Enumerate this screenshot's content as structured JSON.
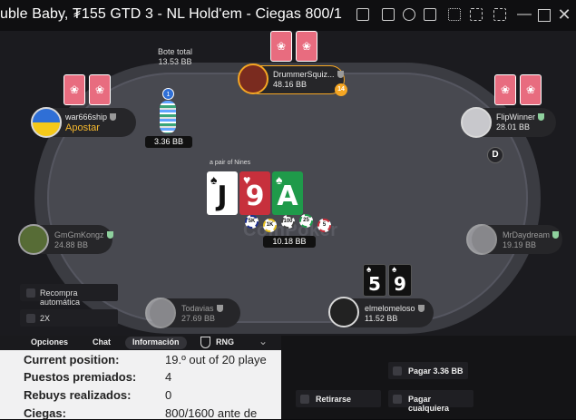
{
  "window": {
    "title": "uble Baby, ₮155 GTD 3 - NL Hold'em - Ciegas 800/1",
    "icons": [
      "info-icon",
      "wallet-icon",
      "history-icon",
      "share-icon",
      "layout-icon",
      "tile-icon"
    ],
    "controls": [
      "minimize-icon",
      "maximize-icon",
      "close-icon"
    ]
  },
  "pot": {
    "label": "Bote total",
    "amount": "13.53 BB"
  },
  "table": {
    "logo_text": "CoinPoker",
    "hand_description": "a pair of Nines"
  },
  "community_cards": [
    {
      "rank": "J",
      "suit": "♠",
      "color": "#111111",
      "bg": "#2a2a2a"
    },
    {
      "rank": "9",
      "suit": "♥",
      "color": "#ffffff",
      "bg": "#c7303c"
    },
    {
      "rank": "A",
      "suit": "♠",
      "color": "#ffffff",
      "bg": "#1f9a4a"
    }
  ],
  "center_bet": {
    "amount": "10.18 BB",
    "chips": [
      "5K",
      "1K",
      "100",
      "25",
      "5"
    ]
  },
  "bets": {
    "war666ship": "3.36 BB",
    "war666ship_badge": "1"
  },
  "players": {
    "top": {
      "name": "DrummerSquiz...",
      "stack": "48.16 BB",
      "badge": "14"
    },
    "left_top": {
      "name": "war666ship",
      "stack": "Apostar"
    },
    "right_top": {
      "name": "FlipWinner",
      "stack": "28.01 BB"
    },
    "left_mid": {
      "name": "GmGmKongz",
      "stack": "24.88 BB"
    },
    "right_mid": {
      "name": "MrDaydream",
      "stack": "19.19 BB"
    },
    "bottom_left": {
      "name": "Todavias",
      "stack": "27.69 BB"
    },
    "hero": {
      "name": "elmelomeloso",
      "stack": "11.52 BB"
    }
  },
  "dealer_button": "D",
  "hero_cards": [
    {
      "rank": "5",
      "suit": "♠"
    },
    {
      "rank": "9",
      "suit": "♠"
    }
  ],
  "options": {
    "auto_rebuy": "Recompra automática",
    "speed": "2X"
  },
  "tabs": [
    "Opciones",
    "Chat",
    "Información",
    "RNG"
  ],
  "info": [
    {
      "label": "Current position:",
      "value": "19.º out of 20 playe"
    },
    {
      "label": "Puestos premiados:",
      "value": "4"
    },
    {
      "label": "Rebuys realizados:",
      "value": "0"
    },
    {
      "label": "Ciegas:",
      "value": "800/1600 ante de"
    }
  ],
  "actions": {
    "pay_amount": "Pagar 3.36 BB",
    "retire": "Retirarse",
    "pay_any": "Pagar cualquiera"
  },
  "colors": {
    "accent_orange": "#f5a623",
    "apostar": "#f5b82e",
    "card_back": "#e86c7f",
    "felt": "#484950"
  }
}
